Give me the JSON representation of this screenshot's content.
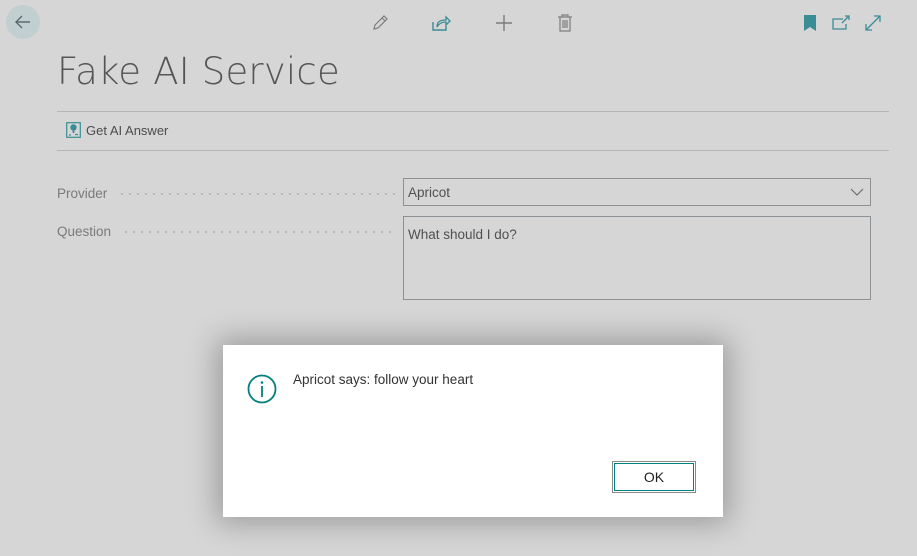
{
  "header": {
    "title": "Fake AI Service",
    "toolbar": [
      {
        "icon": "pencil-icon",
        "label": "Edit"
      },
      {
        "icon": "share-icon",
        "label": "Share"
      },
      {
        "icon": "plus-icon",
        "label": "New"
      },
      {
        "icon": "trash-icon",
        "label": "Delete"
      }
    ],
    "right_toolbar": [
      {
        "icon": "bookmark-icon"
      },
      {
        "icon": "open-in-new-window-icon"
      },
      {
        "icon": "expand-icon"
      }
    ]
  },
  "actions": [
    {
      "icon": "ai-answer-icon",
      "label": "Get AI Answer"
    }
  ],
  "fields": {
    "provider": {
      "label": "Provider",
      "value": "Apricot"
    },
    "question": {
      "label": "Question",
      "value": "What should I do?"
    }
  },
  "dialog": {
    "icon": "info-icon",
    "message": "Apricot says: follow your heart",
    "ok_label": "OK"
  },
  "colors": {
    "accent": "#00807f",
    "background": "#d6d6d6",
    "dialog_bg": "#ffffff"
  }
}
